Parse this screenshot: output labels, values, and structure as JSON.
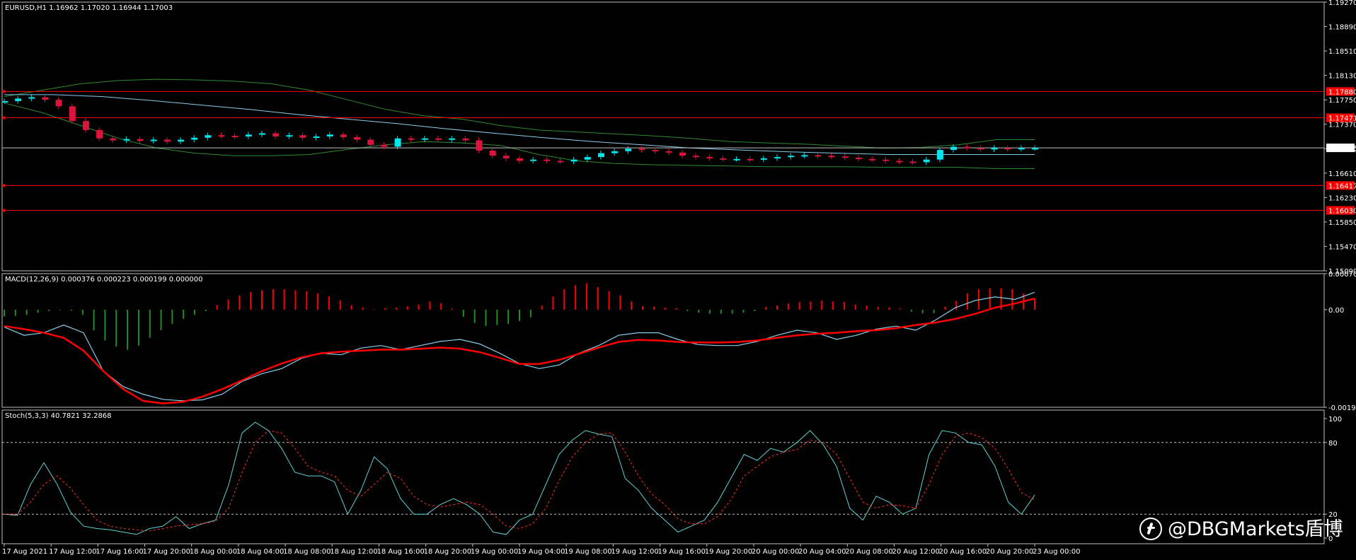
{
  "colors": {
    "background": "#000000",
    "frame": "#c0c0c0",
    "bull_candle": "#00e5ee",
    "bear_candle": "#dc143c",
    "level_line": "#ff0000",
    "bollinger": "#2e8b2e",
    "moving_average": "#87ceeb",
    "price_line": "#c0c0c0",
    "macd_hist_pos": "#ff0000",
    "macd_hist_neg": "#228b22",
    "macd_line": "#87ceeb",
    "signal_line": "#ff0000",
    "stoch_main": "#5fd3d3",
    "stoch_signal": "#ff3030",
    "level_label_bg": "#ff0000",
    "price_label_bg": "#ffffff"
  },
  "price_panel": {
    "title": "EURUSD,H1  1.16962 1.17020 1.16944 1.17003",
    "current_price": "1.17003"
  },
  "macd_panel": {
    "title": "MACD(12,26,9) 0.000376 0.000223 0.000199 0.000000"
  },
  "stoch_panel": {
    "title": "Stoch(5,3,3) 40.7821 32.2868"
  },
  "watermark": {
    "text": "@DBGMarkets盾博",
    "icon": "weibo-logo-icon"
  },
  "chart_data": [
    {
      "type": "candlestick",
      "title": "EURUSD,H1  1.16962 1.17020 1.16944 1.17003",
      "ylim": [
        1.1509,
        1.1927
      ],
      "y_ticks": [
        "1.19270",
        "1.18890",
        "1.18510",
        "1.18130",
        "1.17750",
        "1.17370",
        "1.16990",
        "1.16610",
        "1.16230",
        "1.15850",
        "1.15470",
        "1.15090"
      ],
      "x_ticks": [
        "17 Aug 2021",
        "17 Aug 12:00",
        "17 Aug 16:00",
        "17 Aug 20:00",
        "18 Aug 00:00",
        "18 Aug 04:00",
        "18 Aug 08:00",
        "18 Aug 12:00",
        "18 Aug 16:00",
        "18 Aug 20:00",
        "19 Aug 00:00",
        "19 Aug 04:00",
        "19 Aug 08:00",
        "19 Aug 12:00",
        "19 Aug 16:00",
        "19 Aug 20:00",
        "20 Aug 00:00",
        "20 Aug 04:00",
        "20 Aug 08:00",
        "20 Aug 12:00",
        "20 Aug 16:00",
        "20 Aug 20:00",
        "23 Aug 00:00"
      ],
      "close_series": [
        1.1773,
        1.1777,
        1.1779,
        1.1775,
        1.1765,
        1.1742,
        1.1728,
        1.1715,
        1.1712,
        1.1714,
        1.1711,
        1.1713,
        1.171,
        1.1713,
        1.1716,
        1.172,
        1.1719,
        1.1718,
        1.1721,
        1.1723,
        1.1718,
        1.172,
        1.1716,
        1.1718,
        1.1721,
        1.1717,
        1.1713,
        1.1705,
        1.1702,
        1.1715,
        1.1713,
        1.1715,
        1.1713,
        1.1715,
        1.1712,
        1.1696,
        1.1688,
        1.1684,
        1.168,
        1.1682,
        1.168,
        1.1679,
        1.1682,
        1.1686,
        1.1692,
        1.1695,
        1.1699,
        1.1697,
        1.1695,
        1.1693,
        1.1688,
        1.1686,
        1.1684,
        1.1683,
        1.1683,
        1.1682,
        1.1684,
        1.1686,
        1.1688,
        1.1689,
        1.1688,
        1.1687,
        1.1685,
        1.1683,
        1.1682,
        1.168,
        1.1679,
        1.1678,
        1.1682,
        1.1697,
        1.1702,
        1.17,
        1.1698,
        1.17,
        1.1699,
        1.17,
        1.17
      ],
      "bollinger_upper": [
        1.178,
        1.179,
        1.18,
        1.1805,
        1.1807,
        1.1806,
        1.1804,
        1.18,
        1.179,
        1.1775,
        1.176,
        1.175,
        1.1745,
        1.1735,
        1.1728,
        1.1725,
        1.1722,
        1.1719,
        1.1715,
        1.171,
        1.1708,
        1.1706,
        1.1703,
        1.17,
        1.1701,
        1.1705,
        1.1713,
        1.1713
      ],
      "bollinger_lower": [
        1.177,
        1.1755,
        1.1735,
        1.1715,
        1.17,
        1.1692,
        1.1688,
        1.1688,
        1.169,
        1.1698,
        1.1705,
        1.171,
        1.1708,
        1.1704,
        1.169,
        1.168,
        1.1676,
        1.1674,
        1.1673,
        1.1672,
        1.1671,
        1.1671,
        1.1671,
        1.167,
        1.167,
        1.167,
        1.1668,
        1.1668
      ],
      "moving_average": [
        1.1783,
        1.1783,
        1.178,
        1.1774,
        1.1767,
        1.176,
        1.1752,
        1.1745,
        1.1738,
        1.173,
        1.1723,
        1.1716,
        1.171,
        1.1705,
        1.17,
        1.1697,
        1.1694,
        1.1692,
        1.169,
        1.169,
        1.169,
        1.169
      ],
      "horizontal_levels": [
        {
          "value": 1.1788,
          "label": "1.17880"
        },
        {
          "value": 1.17471,
          "label": "1.17471"
        },
        {
          "value": 1.16417,
          "label": "1.16417"
        },
        {
          "value": 1.1603,
          "label": "1.16030"
        }
      ],
      "current_price": 1.17003
    },
    {
      "type": "macd",
      "title": "MACD(12,26,9) 0.000376 0.000223 0.000199 0.000000",
      "ylim": [
        -0.001905,
        0.000704
      ],
      "y_ticks": [
        "0.000704",
        "0.00",
        "-0.001905"
      ],
      "histogram": [
        -0.00013,
        -0.00012,
        -0.0001,
        -6e-05,
        -3e-05,
        -1e-05,
        -2e-05,
        -0.0001,
        -0.0004,
        -0.0006,
        -0.00072,
        -0.00078,
        -0.0007,
        -0.00055,
        -0.0004,
        -0.00028,
        -0.00018,
        -0.0001,
        -3e-05,
        9e-05,
        0.0002,
        0.00028,
        0.00034,
        0.00038,
        0.0004,
        0.0004,
        0.00038,
        0.00036,
        0.00032,
        0.00026,
        0.00018,
        9e-05,
        4e-05,
        1e-05,
        3e-05,
        4e-05,
        7e-05,
        0.0001,
        0.00016,
        0.00013,
        2e-05,
        -0.00014,
        -0.00026,
        -0.00032,
        -0.0003,
        -0.00028,
        -0.00022,
        -0.00015,
        8e-05,
        0.00026,
        0.0004,
        0.00048,
        0.00052,
        0.00044,
        0.00036,
        0.00028,
        0.00016,
        7e-05,
        6e-05,
        4e-05,
        3e-05,
        -3e-05,
        -6e-05,
        -8e-05,
        -8e-05,
        -8e-05,
        -6e-05,
        -3e-05,
        5e-05,
        8e-05,
        0.00012,
        0.00015,
        0.00016,
        0.00018,
        0.00016,
        0.00015,
        0.0001,
        8e-05,
        5e-05,
        4e-05,
        2e-05,
        -4e-05,
        -7e-05,
        -7e-05,
        6e-05,
        0.00017,
        0.00032,
        0.0004,
        0.00042,
        0.00042,
        0.0004,
        0.00032,
        0.00022
      ],
      "macd_line": [
        -0.00034,
        -0.0005,
        -0.00045,
        -0.0003,
        -0.00045,
        -0.0012,
        -0.0015,
        -0.00165,
        -0.00175,
        -0.00178,
        -0.00176,
        -0.00165,
        -0.0014,
        -0.00125,
        -0.00115,
        -0.00095,
        -0.00085,
        -0.00088,
        -0.00075,
        -0.0007,
        -0.00078,
        -0.0007,
        -0.00062,
        -0.00058,
        -0.00067,
        -0.00085,
        -0.00105,
        -0.00115,
        -0.00108,
        -0.00085,
        -0.0007,
        -0.0005,
        -0.00045,
        -0.00045,
        -0.00058,
        -0.00068,
        -0.0007,
        -0.0007,
        -0.00062,
        -0.0005,
        -0.0004,
        -0.00045,
        -0.00058,
        -0.0005,
        -0.00038,
        -0.00032,
        -0.0004,
        -0.0002,
        4e-05,
        0.00018,
        0.00025,
        0.0002,
        0.00034
      ],
      "signal_line": [
        -0.00032,
        -0.00038,
        -0.00045,
        -0.00055,
        -0.0008,
        -0.0012,
        -0.00155,
        -0.00178,
        -0.00183,
        -0.0018,
        -0.0017,
        -0.00155,
        -0.00138,
        -0.0012,
        -0.00105,
        -0.00093,
        -0.00085,
        -0.00082,
        -0.0008,
        -0.00078,
        -0.00078,
        -0.00076,
        -0.00074,
        -0.00076,
        -0.00083,
        -0.00094,
        -0.00106,
        -0.00106,
        -0.00098,
        -0.00086,
        -0.00074,
        -0.00063,
        -0.00059,
        -0.0006,
        -0.00063,
        -0.00064,
        -0.00064,
        -0.00063,
        -0.0006,
        -0.00055,
        -0.0005,
        -0.00047,
        -0.00045,
        -0.00042,
        -0.0004,
        -0.00036,
        -0.0003,
        -0.00025,
        -0.00018,
        -8e-05,
        4e-05,
        0.00012,
        0.00022
      ]
    },
    {
      "type": "stochastic",
      "title": "Stoch(5,3,3) 40.7821 32.2868",
      "ylim": [
        0,
        100
      ],
      "y_ticks": [
        "100",
        "80",
        "20",
        "0"
      ],
      "levels": [
        80,
        20
      ],
      "main_line": [
        20,
        19,
        45,
        63,
        45,
        22,
        10,
        8,
        7,
        5,
        3,
        8,
        10,
        18,
        8,
        12,
        15,
        45,
        88,
        97,
        90,
        75,
        55,
        52,
        52,
        47,
        20,
        40,
        68,
        58,
        33,
        20,
        20,
        28,
        33,
        28,
        20,
        5,
        3,
        15,
        20,
        45,
        70,
        82,
        90,
        87,
        85,
        50,
        40,
        25,
        15,
        5,
        10,
        15,
        30,
        50,
        70,
        65,
        75,
        72,
        80,
        90,
        78,
        60,
        25,
        15,
        35,
        30,
        20,
        25,
        70,
        90,
        88,
        80,
        78,
        60,
        30,
        20,
        36
      ],
      "signal_line": [
        20,
        20,
        30,
        45,
        52,
        42,
        28,
        15,
        10,
        8,
        7,
        6,
        8,
        10,
        11,
        12,
        14,
        25,
        55,
        80,
        90,
        88,
        75,
        60,
        55,
        52,
        40,
        35,
        45,
        55,
        50,
        35,
        28,
        26,
        28,
        30,
        28,
        20,
        10,
        8,
        12,
        25,
        48,
        68,
        80,
        87,
        88,
        72,
        52,
        37,
        28,
        16,
        12,
        12,
        18,
        32,
        52,
        60,
        68,
        72,
        74,
        82,
        80,
        70,
        50,
        30,
        25,
        28,
        27,
        25,
        45,
        70,
        85,
        88,
        84,
        75,
        58,
        38,
        32
      ]
    }
  ]
}
